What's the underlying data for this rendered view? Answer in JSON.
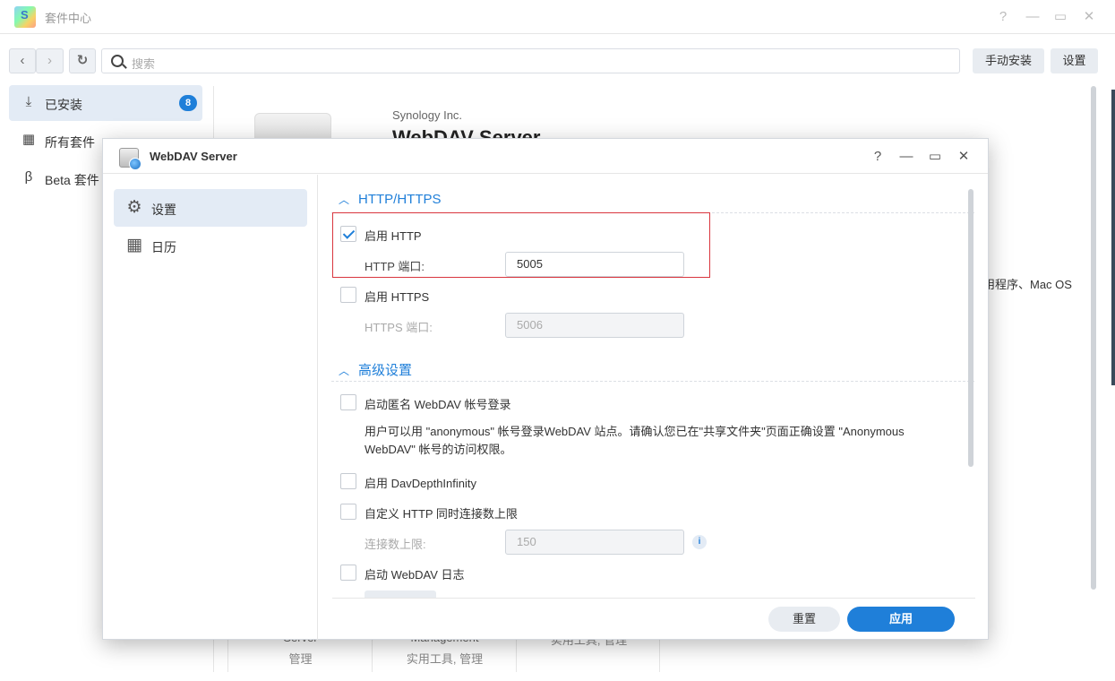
{
  "background_window": {
    "title": "套件中心",
    "controls": {
      "help": "?",
      "minimize": "—",
      "maximize": "▭",
      "close": "✕"
    },
    "toolbar": {
      "search_placeholder": "搜索",
      "manual_install_label": "手动安装",
      "settings_label": "设置"
    },
    "sidebar": [
      {
        "label": "已安装",
        "icon": "download-icon",
        "badge": "8",
        "active": true
      },
      {
        "label": "所有套件",
        "icon": "grid-icon",
        "active": false
      },
      {
        "label": "Beta 套件",
        "icon": "beta-icon",
        "active": false
      }
    ],
    "detail": {
      "vendor": "Synology Inc.",
      "name": "WebDAV Server",
      "desc_tail": "用程序、Mac OS"
    },
    "cards": [
      {
        "title": "Server",
        "sub": "管理"
      },
      {
        "title": "Management",
        "sub": "实用工具, 管理"
      },
      {
        "title": "",
        "sub": "实用工具, 管理"
      }
    ]
  },
  "modal": {
    "title": "WebDAV Server",
    "controls": {
      "help": "?",
      "minimize": "—",
      "maximize": "▭",
      "close": "✕"
    },
    "sidebar": [
      {
        "label": "设置",
        "icon": "gear-icon",
        "active": true
      },
      {
        "label": "日历",
        "icon": "calendar-icon",
        "active": false
      }
    ],
    "sections": {
      "http_https": {
        "title": "HTTP/HTTPS",
        "enable_http_label": "启用 HTTP",
        "enable_http_checked": true,
        "http_port_label": "HTTP 端口:",
        "http_port_value": "5005",
        "enable_https_label": "启用 HTTPS",
        "enable_https_checked": false,
        "https_port_label": "HTTPS 端口:",
        "https_port_value": "5006"
      },
      "advanced": {
        "title": "高级设置",
        "anonymous_label": "启动匿名 WebDAV 帐号登录",
        "anonymous_desc": "用户可以用 \"anonymous\" 帐号登录WebDAV 站点。请确认您已在\"共享文件夹\"页面正确设置 \"Anonymous WebDAV\" 帐号的访问权限。",
        "depth_infinity_label": "启用 DavDepthInfinity",
        "custom_conn_label": "自定义 HTTP 同时连接数上限",
        "conn_limit_label": "连接数上限:",
        "conn_limit_value": "150",
        "info_icon": "i",
        "webdav_log_label": "启动 WebDAV 日志"
      }
    },
    "footer": {
      "reset_label": "重置",
      "apply_label": "应用"
    },
    "accent_color": "#1f7fd9",
    "highlight_color": "#d9363e"
  }
}
